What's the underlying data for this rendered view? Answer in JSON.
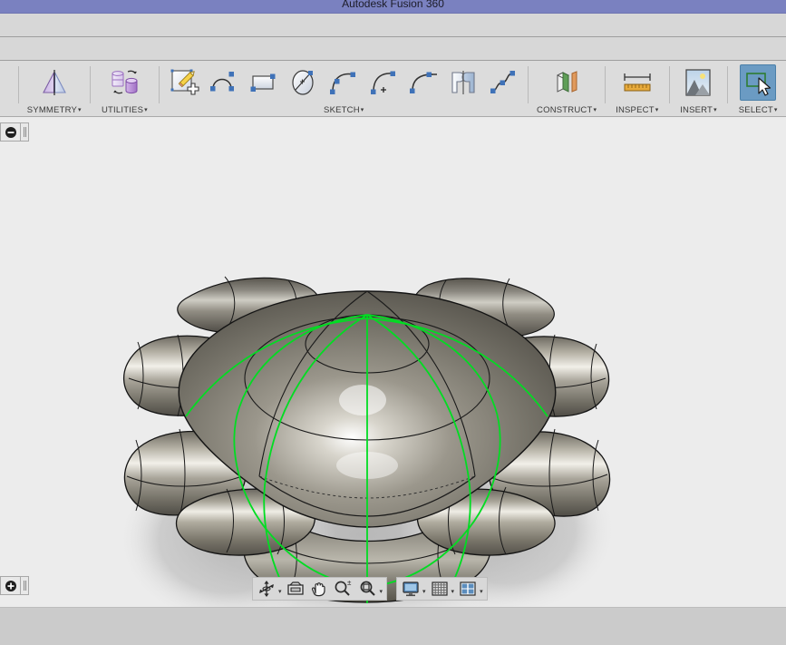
{
  "window": {
    "title": "Autodesk Fusion 360",
    "titlebar_color": "#7a81c0"
  },
  "toolbar_strips": [
    {
      "name": "application-bar",
      "content": ""
    },
    {
      "name": "tabs-bar",
      "content": ""
    }
  ],
  "ribbon": {
    "panels": [
      {
        "id": "modify-partial",
        "label": "",
        "buttons": [
          {
            "name": "modify-tool-icon",
            "tooltip": ""
          }
        ]
      },
      {
        "id": "symmetry",
        "label": "SYMMETRY",
        "caret": "▾",
        "buttons": [
          {
            "name": "mirror-internal-icon",
            "tooltip": "Mirror - Internal"
          }
        ]
      },
      {
        "id": "utilities",
        "label": "UTILITIES",
        "caret": "▾",
        "buttons": [
          {
            "name": "convert-icon",
            "tooltip": "Convert"
          }
        ]
      },
      {
        "id": "sketch",
        "label": "SKETCH",
        "caret": "▾",
        "buttons": [
          {
            "name": "create-sketch-icon",
            "tooltip": "Create Sketch"
          },
          {
            "name": "line-icon",
            "tooltip": "Line"
          },
          {
            "name": "rectangle-icon",
            "tooltip": "Rectangle"
          },
          {
            "name": "circle-icon",
            "tooltip": "Circle"
          },
          {
            "name": "arc-3point-icon",
            "tooltip": "3-Point Arc"
          },
          {
            "name": "arc-center-point-icon",
            "tooltip": "Center Point Arc"
          },
          {
            "name": "arc-tangent-icon",
            "tooltip": "Tangent Arc"
          },
          {
            "name": "mirror-sketch-icon",
            "tooltip": "Mirror"
          },
          {
            "name": "spline-icon",
            "tooltip": "Fit Point Spline"
          }
        ]
      },
      {
        "id": "construct",
        "label": "CONSTRUCT",
        "caret": "▾",
        "buttons": [
          {
            "name": "construct-plane-icon",
            "tooltip": "Offset Plane"
          }
        ]
      },
      {
        "id": "inspect",
        "label": "INSPECT",
        "caret": "▾",
        "buttons": [
          {
            "name": "measure-icon",
            "tooltip": "Measure"
          }
        ]
      },
      {
        "id": "insert",
        "label": "INSERT",
        "caret": "▾",
        "buttons": [
          {
            "name": "insert-image-icon",
            "tooltip": "Canvas"
          }
        ]
      },
      {
        "id": "select",
        "label": "SELECT",
        "caret": "▾",
        "active": true,
        "buttons": [
          {
            "name": "select-window-icon",
            "tooltip": "Select"
          }
        ]
      }
    ]
  },
  "viewport": {
    "background_color": "#ececec",
    "panel_toggles": [
      {
        "name": "collapse-browser-button",
        "glyph": "−"
      },
      {
        "name": "expand-panel-button",
        "glyph": "+"
      }
    ],
    "model": {
      "name": "t-spline-body",
      "description": "Sculpted T-Spline body with eight radial lobes",
      "surface_color": "#8e8a7f",
      "highlight_color": "#ffffff",
      "edge_color": "#000000",
      "symmetry_curve_color": "#00dd22",
      "shadow_color": "#c2c2c2"
    }
  },
  "navbar": {
    "groups": [
      {
        "name": "navigation-group",
        "buttons": [
          {
            "name": "orbit-icon",
            "label": "Orbit",
            "has_caret": true
          },
          {
            "name": "look-at-icon",
            "label": "Look At",
            "has_caret": false
          },
          {
            "name": "pan-icon",
            "label": "Pan",
            "has_caret": false
          },
          {
            "name": "zoom-icon",
            "label": "Zoom",
            "has_caret": false
          },
          {
            "name": "fit-icon",
            "label": "Fit",
            "has_caret": true
          }
        ]
      },
      {
        "name": "display-group",
        "buttons": [
          {
            "name": "display-settings-icon",
            "label": "Display Settings",
            "has_caret": true
          },
          {
            "name": "grid-snaps-icon",
            "label": "Grid and Snaps",
            "has_caret": true
          },
          {
            "name": "viewports-icon",
            "label": "Viewports",
            "has_caret": true
          }
        ]
      }
    ]
  },
  "statusbar": {
    "text": ""
  }
}
